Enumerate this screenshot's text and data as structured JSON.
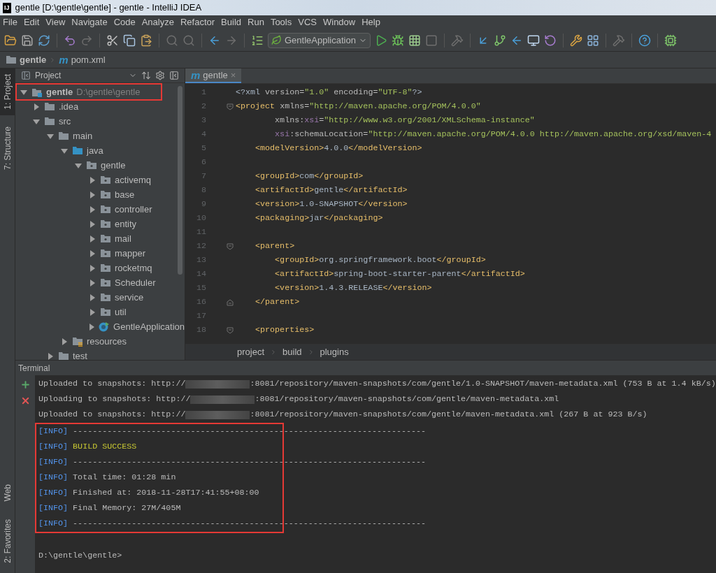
{
  "window": {
    "title": "gentle [D:\\gentle\\gentle] - gentle - IntelliJ IDEA",
    "app_badge": "IJ"
  },
  "menu": [
    "File",
    "Edit",
    "View",
    "Navigate",
    "Code",
    "Analyze",
    "Refactor",
    "Build",
    "Run",
    "Tools",
    "VCS",
    "Window",
    "Help"
  ],
  "toolbar": {
    "run_config": "GentleApplication"
  },
  "nav_bar": [
    {
      "kind": "module",
      "label": "gentle"
    },
    {
      "kind": "maven",
      "badge": "m",
      "label": "pom.xml"
    }
  ],
  "tool_strip": {
    "top": [
      {
        "label": "1: Project",
        "selected": true
      },
      {
        "label": "7: Structure",
        "selected": false
      }
    ],
    "bottom": [
      {
        "label": "Web",
        "selected": false
      },
      {
        "label": "2: Favorites",
        "selected": false
      }
    ]
  },
  "project_panel": {
    "title": "Project",
    "tree": [
      {
        "kind": "module",
        "label": "gentle",
        "path": "D:\\gentle\\gentle",
        "highlighted": true,
        "expanded": true,
        "children": [
          {
            "kind": "folder",
            "label": ".idea",
            "expanded": false
          },
          {
            "kind": "folder",
            "label": "src",
            "expanded": true,
            "children": [
              {
                "kind": "folder",
                "label": "main",
                "expanded": true,
                "children": [
                  {
                    "kind": "source",
                    "label": "java",
                    "expanded": true,
                    "children": [
                      {
                        "kind": "package",
                        "label": "gentle",
                        "expanded": true,
                        "children": [
                          {
                            "kind": "package",
                            "label": "activemq",
                            "expanded": false
                          },
                          {
                            "kind": "package",
                            "label": "base",
                            "expanded": false
                          },
                          {
                            "kind": "package",
                            "label": "controller",
                            "expanded": false
                          },
                          {
                            "kind": "package",
                            "label": "entity",
                            "expanded": false
                          },
                          {
                            "kind": "package",
                            "label": "mail",
                            "expanded": false
                          },
                          {
                            "kind": "package",
                            "label": "mapper",
                            "expanded": false
                          },
                          {
                            "kind": "package",
                            "label": "rocketmq",
                            "expanded": false
                          },
                          {
                            "kind": "package",
                            "label": "Scheduler",
                            "expanded": false
                          },
                          {
                            "kind": "package",
                            "label": "service",
                            "expanded": false
                          },
                          {
                            "kind": "package",
                            "label": "util",
                            "expanded": false
                          },
                          {
                            "kind": "class",
                            "label": "GentleApplication",
                            "expanded": false
                          }
                        ]
                      }
                    ]
                  },
                  {
                    "kind": "resources",
                    "label": "resources",
                    "expanded": false
                  }
                ]
              },
              {
                "kind": "folder",
                "label": "test",
                "expanded": false
              }
            ]
          }
        ]
      }
    ]
  },
  "editor": {
    "tabs": [
      {
        "badge": "m",
        "label": "gentle",
        "close": "×",
        "selected": true
      }
    ],
    "lines": [
      {
        "number": "1",
        "tokens": [
          {
            "kind": "plain",
            "text": "<?xml "
          },
          {
            "kind": "attr",
            "text": "version="
          },
          {
            "kind": "value",
            "text": "\"1.0\""
          },
          {
            "kind": "attr",
            "text": " encoding="
          },
          {
            "kind": "value",
            "text": "\"UTF-8\""
          },
          {
            "kind": "plain",
            "text": "?>"
          }
        ]
      },
      {
        "number": "2",
        "kind": "fold_start",
        "tokens": [
          {
            "kind": "tag",
            "text": "<project "
          },
          {
            "kind": "attr",
            "text": "xmlns="
          },
          {
            "kind": "value",
            "text": "\"http://maven.apache.org/POM/4.0.0\""
          }
        ]
      },
      {
        "number": "3",
        "tokens": [
          {
            "kind": "attr",
            "text": "        xmlns:"
          },
          {
            "kind": "ns",
            "text": "xsi"
          },
          {
            "kind": "attr",
            "text": "="
          },
          {
            "kind": "value",
            "text": "\"http://www.w3.org/2001/XMLSchema-instance\""
          }
        ]
      },
      {
        "number": "4",
        "tokens": [
          {
            "kind": "ns",
            "text": "        xsi"
          },
          {
            "kind": "attr",
            "text": ":schemaLocation="
          },
          {
            "kind": "value",
            "text": "\"http://maven.apache.org/POM/4.0.0 http://maven.apache.org/xsd/maven-4"
          }
        ]
      },
      {
        "number": "5",
        "tokens": [
          {
            "kind": "tag",
            "text": "    <modelVersion>"
          },
          {
            "kind": "plain",
            "text": "4.0.0"
          },
          {
            "kind": "tag",
            "text": "</modelVersion>"
          }
        ]
      },
      {
        "number": "6"
      },
      {
        "number": "7",
        "tokens": [
          {
            "kind": "tag",
            "text": "    <groupId>"
          },
          {
            "kind": "plain",
            "text": "com"
          },
          {
            "kind": "tag",
            "text": "</groupId>"
          }
        ]
      },
      {
        "number": "8",
        "tokens": [
          {
            "kind": "tag",
            "text": "    <artifactId>"
          },
          {
            "kind": "plain",
            "text": "gentle"
          },
          {
            "kind": "tag",
            "text": "</artifactId>"
          }
        ]
      },
      {
        "number": "9",
        "tokens": [
          {
            "kind": "tag",
            "text": "    <version>"
          },
          {
            "kind": "plain",
            "text": "1.0-SNAPSHOT"
          },
          {
            "kind": "tag",
            "text": "</version>"
          }
        ]
      },
      {
        "number": "10",
        "tokens": [
          {
            "kind": "tag",
            "text": "    <packaging>"
          },
          {
            "kind": "plain",
            "text": "jar"
          },
          {
            "kind": "tag",
            "text": "</packaging>"
          }
        ]
      },
      {
        "number": "11"
      },
      {
        "number": "12",
        "kind": "fold_start",
        "tokens": [
          {
            "kind": "tag",
            "text": "    <parent>"
          }
        ]
      },
      {
        "number": "13",
        "tokens": [
          {
            "kind": "tag",
            "text": "        <groupId>"
          },
          {
            "kind": "plain",
            "text": "org.springframework.boot"
          },
          {
            "kind": "tag",
            "text": "</groupId>"
          }
        ]
      },
      {
        "number": "14",
        "tokens": [
          {
            "kind": "tag",
            "text": "        <artifactId>"
          },
          {
            "kind": "plain",
            "text": "spring-boot-starter-parent"
          },
          {
            "kind": "tag",
            "text": "</artifactId>"
          }
        ]
      },
      {
        "number": "15",
        "tokens": [
          {
            "kind": "tag",
            "text": "        <version>"
          },
          {
            "kind": "plain",
            "text": "1.4.3.RELEASE"
          },
          {
            "kind": "tag",
            "text": "</version>"
          }
        ]
      },
      {
        "number": "16",
        "kind": "fold_end",
        "tokens": [
          {
            "kind": "tag",
            "text": "    </parent>"
          }
        ]
      },
      {
        "number": "17"
      },
      {
        "number": "18",
        "kind": "fold_start",
        "tokens": [
          {
            "kind": "tag",
            "text": "    <properties>"
          }
        ]
      }
    ],
    "breadcrumbs": [
      "project",
      "build",
      "plugins"
    ]
  },
  "terminal": {
    "title": "Terminal",
    "blocks": [
      {
        "highlighted": false,
        "gap_before": false,
        "lines": [
          [
            {
              "kind": "plain",
              "text": "Uploaded to snapshots: http://"
            },
            {
              "kind": "redacted"
            },
            {
              "kind": "plain",
              "text": ":8081/repository/maven-snapshots/com/gentle/1.0-SNAPSHOT/maven-metadata.xml (753 B at 1.4 kB/s)"
            }
          ],
          [
            {
              "kind": "plain",
              "text": "Uploading to snapshots: http://"
            },
            {
              "kind": "redacted"
            },
            {
              "kind": "plain",
              "text": ":8081/repository/maven-snapshots/com/gentle/maven-metadata.xml"
            }
          ],
          [
            {
              "kind": "plain",
              "text": "Uploaded to snapshots: http://"
            },
            {
              "kind": "redacted"
            },
            {
              "kind": "plain",
              "text": ":8081/repository/maven-snapshots/com/gentle/maven-metadata.xml (267 B at 923 B/s)"
            }
          ]
        ]
      },
      {
        "highlighted": true,
        "gap_before": false,
        "lines": [
          [
            {
              "kind": "level",
              "text": "[INFO]"
            },
            {
              "kind": "plain",
              "text": " ------------------------------------------------------------------------"
            }
          ],
          [
            {
              "kind": "level",
              "text": "[INFO]"
            },
            {
              "kind": "success",
              "text": " BUILD SUCCESS"
            }
          ],
          [
            {
              "kind": "level",
              "text": "[INFO]"
            },
            {
              "kind": "plain",
              "text": " ------------------------------------------------------------------------"
            }
          ],
          [
            {
              "kind": "level",
              "text": "[INFO]"
            },
            {
              "kind": "plain",
              "text": " Total time: 01:28 min"
            }
          ],
          [
            {
              "kind": "level",
              "text": "[INFO]"
            },
            {
              "kind": "plain",
              "text": " Finished at: 2018-11-28T17:41:55+08:00"
            }
          ],
          [
            {
              "kind": "level",
              "text": "[INFO]"
            },
            {
              "kind": "plain",
              "text": " Final Memory: 27M/405M"
            }
          ],
          [
            {
              "kind": "level",
              "text": "[INFO]"
            },
            {
              "kind": "plain",
              "text": " ------------------------------------------------------------------------"
            }
          ]
        ]
      },
      {
        "highlighted": false,
        "gap_before": true,
        "lines": [
          [
            {
              "kind": "plain",
              "text": "D:\\gentle\\gentle>"
            }
          ]
        ]
      }
    ]
  }
}
